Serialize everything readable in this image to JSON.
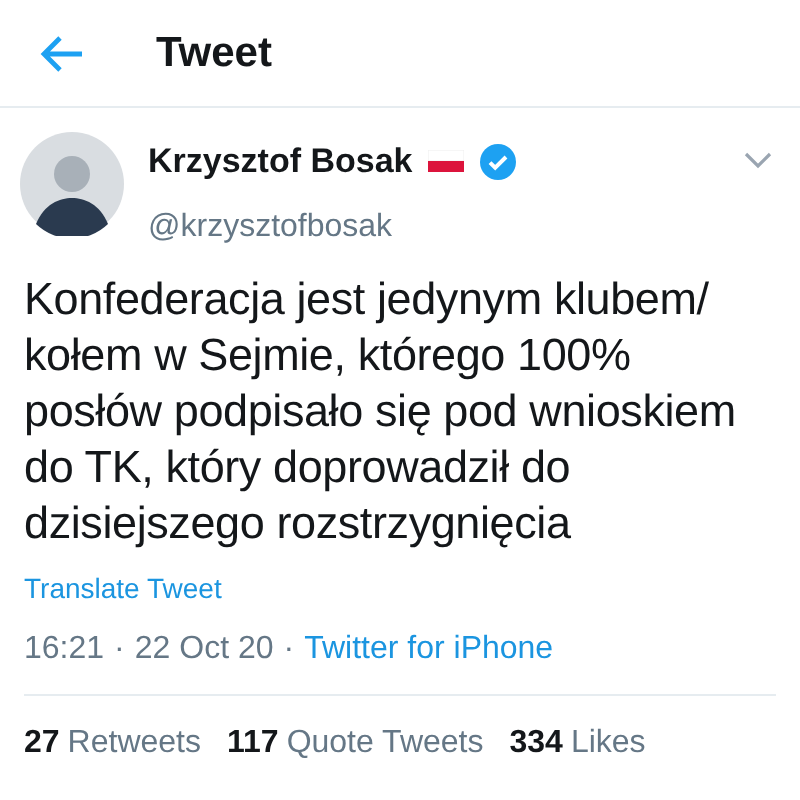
{
  "header": {
    "title": "Tweet"
  },
  "author": {
    "name": "Krzysztof Bosak",
    "handle": "@krzysztofbosak",
    "verified": true
  },
  "tweet": {
    "text": "Konfederacja jest jedynym klubem/ kołem w Sejmie, którego 100% posłów podpisało się pod wnioskiem do TK, który doprowadził do dzisiejszego rozstrzygnięcia",
    "translate": "Translate Tweet"
  },
  "meta": {
    "time": "16:21",
    "separator_1": "·",
    "date": "22 Oct 20",
    "separator_2": "·",
    "source": "Twitter for iPhone"
  },
  "stats": [
    {
      "count": "27",
      "label": "Retweets"
    },
    {
      "count": "117",
      "label": "Quote Tweets"
    },
    {
      "count": "334",
      "label": "Likes"
    }
  ]
}
